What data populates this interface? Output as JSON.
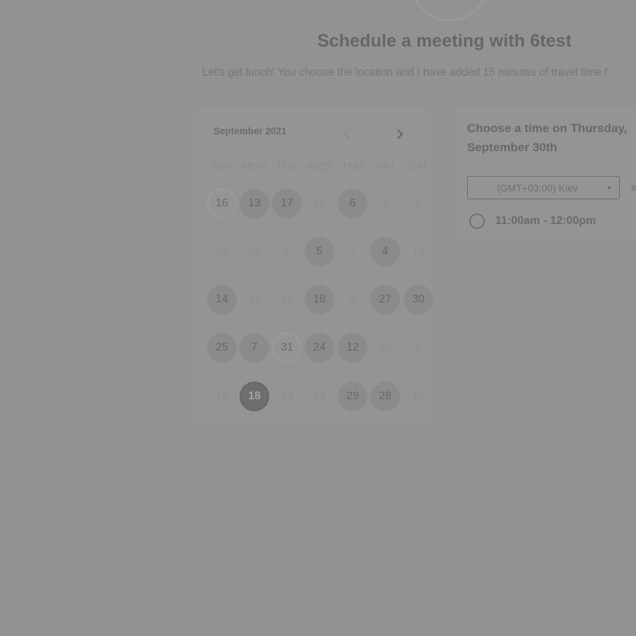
{
  "header": {
    "title": "Schedule a meeting with 6test",
    "subtitle": "Let's get lunch! You choose the location and I have added 15 minutes of travel time f"
  },
  "calendar": {
    "month_label": "September 2021",
    "prev_icon": "chevron-left-icon",
    "next_icon": "chevron-right-icon",
    "weekdays": [
      "SUN",
      "MON",
      "TUE",
      "WED",
      "THU",
      "FRI",
      "SAT"
    ],
    "weeks": [
      [
        {
          "n": "16",
          "s": "dotted"
        },
        {
          "n": "13",
          "s": "avail"
        },
        {
          "n": "17",
          "s": "avail"
        },
        {
          "n": "28",
          "s": "dim"
        },
        {
          "n": "6",
          "s": "avail"
        },
        {
          "n": "3",
          "s": "dim"
        },
        {
          "n": "9",
          "s": "dim"
        }
      ],
      [
        {
          "n": "28",
          "s": "dim"
        },
        {
          "n": "28",
          "s": "dim"
        },
        {
          "n": "2",
          "s": "dim"
        },
        {
          "n": "5",
          "s": "avail"
        },
        {
          "n": "2",
          "s": "dim"
        },
        {
          "n": "4",
          "s": "avail"
        },
        {
          "n": "18",
          "s": "dim"
        }
      ],
      [
        {
          "n": "14",
          "s": "avail"
        },
        {
          "n": "14",
          "s": "dim"
        },
        {
          "n": "15",
          "s": "dim"
        },
        {
          "n": "18",
          "s": "avail"
        },
        {
          "n": "8",
          "s": "dim"
        },
        {
          "n": "27",
          "s": "avail"
        },
        {
          "n": "30",
          "s": "avail"
        }
      ],
      [
        {
          "n": "25",
          "s": "avail"
        },
        {
          "n": "7",
          "s": "avail"
        },
        {
          "n": "31",
          "s": "dotted"
        },
        {
          "n": "24",
          "s": "avail"
        },
        {
          "n": "12",
          "s": "avail"
        },
        {
          "n": "22",
          "s": "dim"
        },
        {
          "n": "5",
          "s": "dim"
        }
      ],
      [
        {
          "n": "12",
          "s": "dim"
        },
        {
          "n": "18",
          "s": "selected"
        },
        {
          "n": "13",
          "s": "dim"
        },
        {
          "n": "14",
          "s": "dim"
        },
        {
          "n": "29",
          "s": "avail"
        },
        {
          "n": "28",
          "s": "avail"
        },
        {
          "n": "12",
          "s": "dim"
        }
      ]
    ]
  },
  "times": {
    "heading": "Choose a time on Thursday, September 30th",
    "timezone": "(GMT+03:00) Kiev",
    "timezone_extra": "a",
    "slots": [
      "11:00am - 12:00pm"
    ]
  },
  "colors": {
    "overlay": "#929292",
    "available_day": "#8b8b8b",
    "selected_day": "#6e6e6e"
  }
}
